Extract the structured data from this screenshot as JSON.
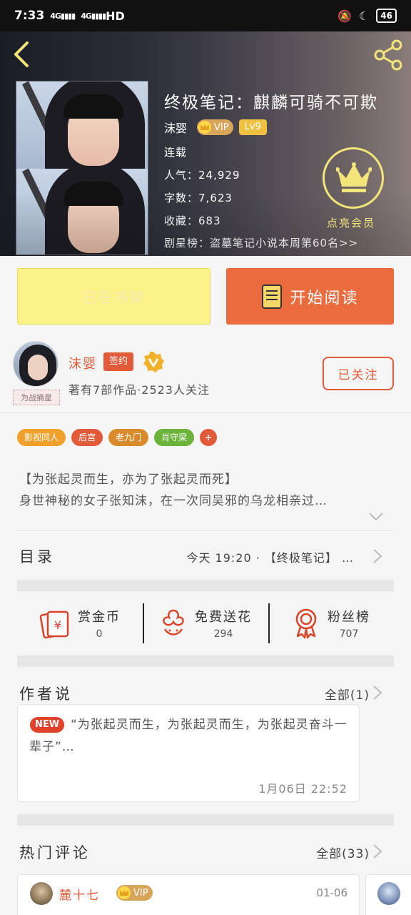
{
  "status_bar": {
    "time": "7:33",
    "signal_1": "4G",
    "signal_2": "4G",
    "hd_label": "HD",
    "battery": "46"
  },
  "book": {
    "title": "终极笔记：麒麟可骑不可欺",
    "author": "沫婴",
    "vip_label": "VIP",
    "level": "Lv9",
    "status": "连载",
    "popularity_label": "人气：",
    "popularity": "24,929",
    "word_count_label": "字数：",
    "word_count": "7,623",
    "favorites_label": "收藏：",
    "favorites": "683",
    "rank_text": "剧星榜：盗墓笔记小说本周第60名>>",
    "vip_member_label": "点亮会员"
  },
  "actions": {
    "shelf_label": "已在书架",
    "read_label": "开始阅读"
  },
  "author": {
    "name": "沫婴",
    "sign_badge": "签约",
    "avatar_caption": "为战摘星",
    "meta": "著有7部作品·2523人关注",
    "follow_label": "已关注"
  },
  "tags": [
    {
      "label": "影视同人",
      "color": "#f0a12b"
    },
    {
      "label": "后宫",
      "color": "#e15b3a"
    },
    {
      "label": "老九门",
      "color": "#d98a2b"
    },
    {
      "label": "肖守梁",
      "color": "#6bb33b"
    },
    {
      "label": "+",
      "color": "#e15b3a"
    }
  ],
  "synopsis": {
    "line1": "【为张起灵而生，亦为了张起灵而死】",
    "line2": "身世神秘的女子张知沫，在一次同吴邪的乌龙相亲过…"
  },
  "catalog": {
    "title": "目录",
    "latest": "今天 19:20 · 【终极笔记】 …"
  },
  "rewards": [
    {
      "label": "赏金币",
      "value": "0"
    },
    {
      "label": "免费送花",
      "value": "294"
    },
    {
      "label": "粉丝榜",
      "value": "707"
    }
  ],
  "author_says": {
    "title": "作者说",
    "all_label": "全部(1)",
    "new_badge": "NEW",
    "text": "“为张起灵而生，为张起灵而生，为张起灵奋斗一辈子”…",
    "date": "1月06日  22:52"
  },
  "hot_comments": {
    "title": "热门评论",
    "all_label": "全部(33)",
    "items": [
      {
        "name": "麓十七",
        "vip": "VIP",
        "date": "01-06"
      }
    ]
  },
  "colors": {
    "accent": "#e15b3a",
    "read_button": "#ea6b3d",
    "shelf_button": "#fcf28a",
    "vip_gold": "#f3e57a"
  }
}
